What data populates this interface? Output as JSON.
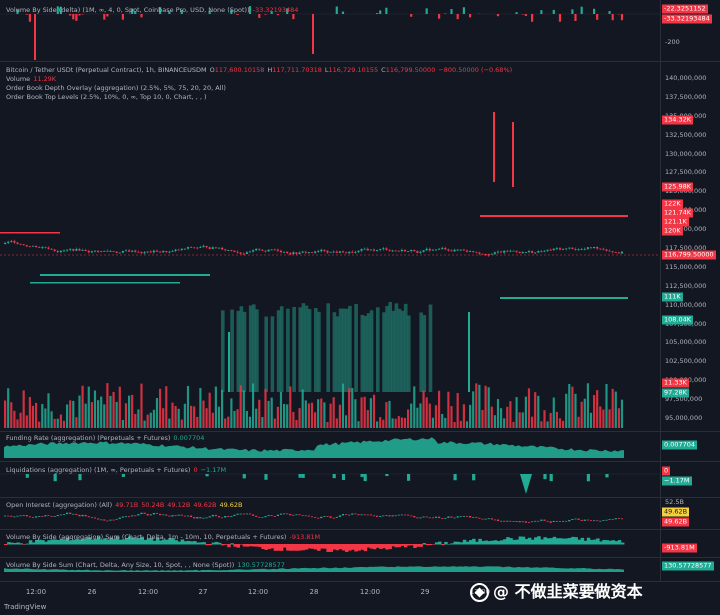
{
  "panes": {
    "vbs_top": {
      "legend": "Volume By Side (delta) (1M, ∞, 4, 0, Spot, Coinbase Pro, USD, None (Spot))",
      "value": "-33.32193484",
      "ticks": [
        "-200"
      ],
      "tags": [
        "-22.3251152",
        "-33.32193484"
      ]
    },
    "main": {
      "symbol": "Bitcoin / Tether USDt (Perpetual Contract), 1h, BINANCEUSDM",
      "ohlc": {
        "o_label": "O",
        "o": "117,600.10158",
        "h_label": "H",
        "h": "117,711.70318",
        "l_label": "L",
        "l": "116,729.10155",
        "c_label": "C",
        "c": "116,799.50000",
        "change": "−800.50000 (−0.68%)"
      },
      "volume_label": "Volume",
      "volume_value": "11.29K",
      "depth_overlay": "Order Book Depth Overlay (aggregation) (2.5%, 5%, 75, 20, 20, All)",
      "top_levels": "Order Book Top Levels (2.5%, 10%, 0, ∞, Top 10, 0, Chart, , , )",
      "ticks": [
        "140,000,000",
        "137,500,000",
        "135,000,000",
        "132,500,000",
        "130,000,000",
        "127,500,000",
        "125,000,000",
        "122,500,000",
        "120,000,000",
        "117,500,000",
        "115,000,000",
        "112,500,000",
        "110,000,000",
        "107,500,000",
        "105,000,000",
        "102,500,000",
        "100,000,000",
        "97,500,000",
        "95,000,000"
      ],
      "tags": [
        {
          "text": "134.32K",
          "c": "r"
        },
        {
          "text": "125.98K",
          "c": "r"
        },
        {
          "text": "122K",
          "c": "r"
        },
        {
          "text": "121.74K",
          "c": "r"
        },
        {
          "text": "121.1K",
          "c": "r"
        },
        {
          "text": "120K",
          "c": "r"
        },
        {
          "text": "116,799.50000",
          "c": "r"
        },
        {
          "text": "111K",
          "c": "g"
        },
        {
          "text": "108.04K",
          "c": "g"
        },
        {
          "text": "11.33K",
          "c": "r"
        },
        {
          "text": "97.28K",
          "c": "g"
        }
      ]
    },
    "funding": {
      "legend": "Funding Rate (aggregation) (Perpetuals + Futures)",
      "value": "0.007704",
      "tags": [
        "0.007704"
      ]
    },
    "liq": {
      "legend": "Liquidations (aggregation) (1M, ∞, Perpetuals + Futures)",
      "v1": "0",
      "v2": "−1.17M",
      "tags": [
        "0",
        "−1.17M"
      ]
    },
    "oi": {
      "legend": "Open Interest (aggregation) (All)",
      "values": [
        "49.71B",
        "50.24B",
        "49.12B",
        "49.62B",
        "49.62B"
      ],
      "ticks": [
        "52.5B"
      ],
      "tags": [
        "49.62B",
        "49.62B"
      ]
    },
    "vbs_agg": {
      "legend": "Volume By Side (aggregation) Sum (Chart, Delta, 1m - 10m, 10, Perpetuals + Futures)",
      "value": "-913.81M",
      "tags": [
        "-913.81M"
      ]
    },
    "vbs_sum": {
      "legend": "Volume By Side Sum (Chart, Delta, Any Size, 10, Spot, , , None (Spot))",
      "value": "130.57728577",
      "tags": [
        "130.57728577"
      ]
    }
  },
  "x_axis": [
    "12:00",
    "26",
    "12:00",
    "27",
    "12:00",
    "28",
    "12:00",
    "29",
    "12:00",
    "30",
    "12:00"
  ],
  "brand": "TradingView",
  "watermark": "@ 不做韭菜要做资本",
  "colors": {
    "bg": "#131722",
    "up": "#22ab94",
    "down": "#f23645",
    "accent": "#f5d142"
  },
  "chart_data": {
    "type": "candlestick",
    "symbol": "Bitcoin / Tether USDt (Perpetual Contract), 1h, BINANCEUSDM",
    "last": {
      "open": 117600.10158,
      "high": 117711.70318,
      "low": 116729.10155,
      "close": 116799.5
    },
    "y_ticks": [
      140000000,
      137500000,
      135000000,
      132500000,
      130000000,
      127500000,
      125000000,
      122500000,
      120000000,
      117500000,
      115000000,
      112500000,
      110000000,
      107500000,
      105000000,
      102500000,
      100000000,
      97500000,
      95000000
    ],
    "x_ticks": [
      "12:00",
      "26",
      "12:00",
      "27",
      "12:00",
      "28",
      "12:00",
      "29",
      "12:00",
      "30",
      "12:00"
    ],
    "price_range": [
      116000,
      119000
    ],
    "funding_rate_last": 0.007704,
    "liquidations_last": [
      0,
      -1170000
    ],
    "open_interest": [
      49.71,
      50.24,
      49.12,
      49.62,
      49.62
    ],
    "volume_by_side_agg_last": -913810000,
    "volume_by_side_sum_last": 130.57728577
  }
}
